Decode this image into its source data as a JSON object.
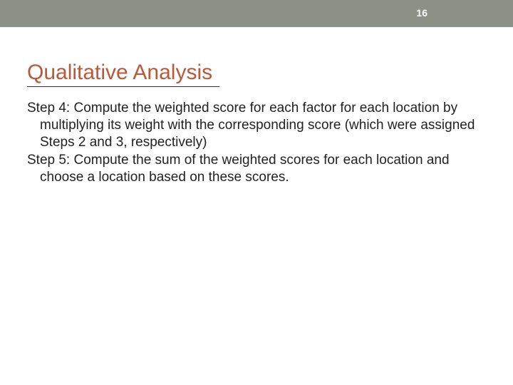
{
  "slide": {
    "page_number": "16",
    "title": "Qualitative Analysis",
    "steps": [
      "Step 4: Compute the weighted score for each factor for each location by multiplying its weight with the corresponding score (which were assigned Steps 2 and 3, respectively)",
      "Step 5: Compute the sum of the weighted scores for each location and choose a location based on these scores."
    ]
  }
}
